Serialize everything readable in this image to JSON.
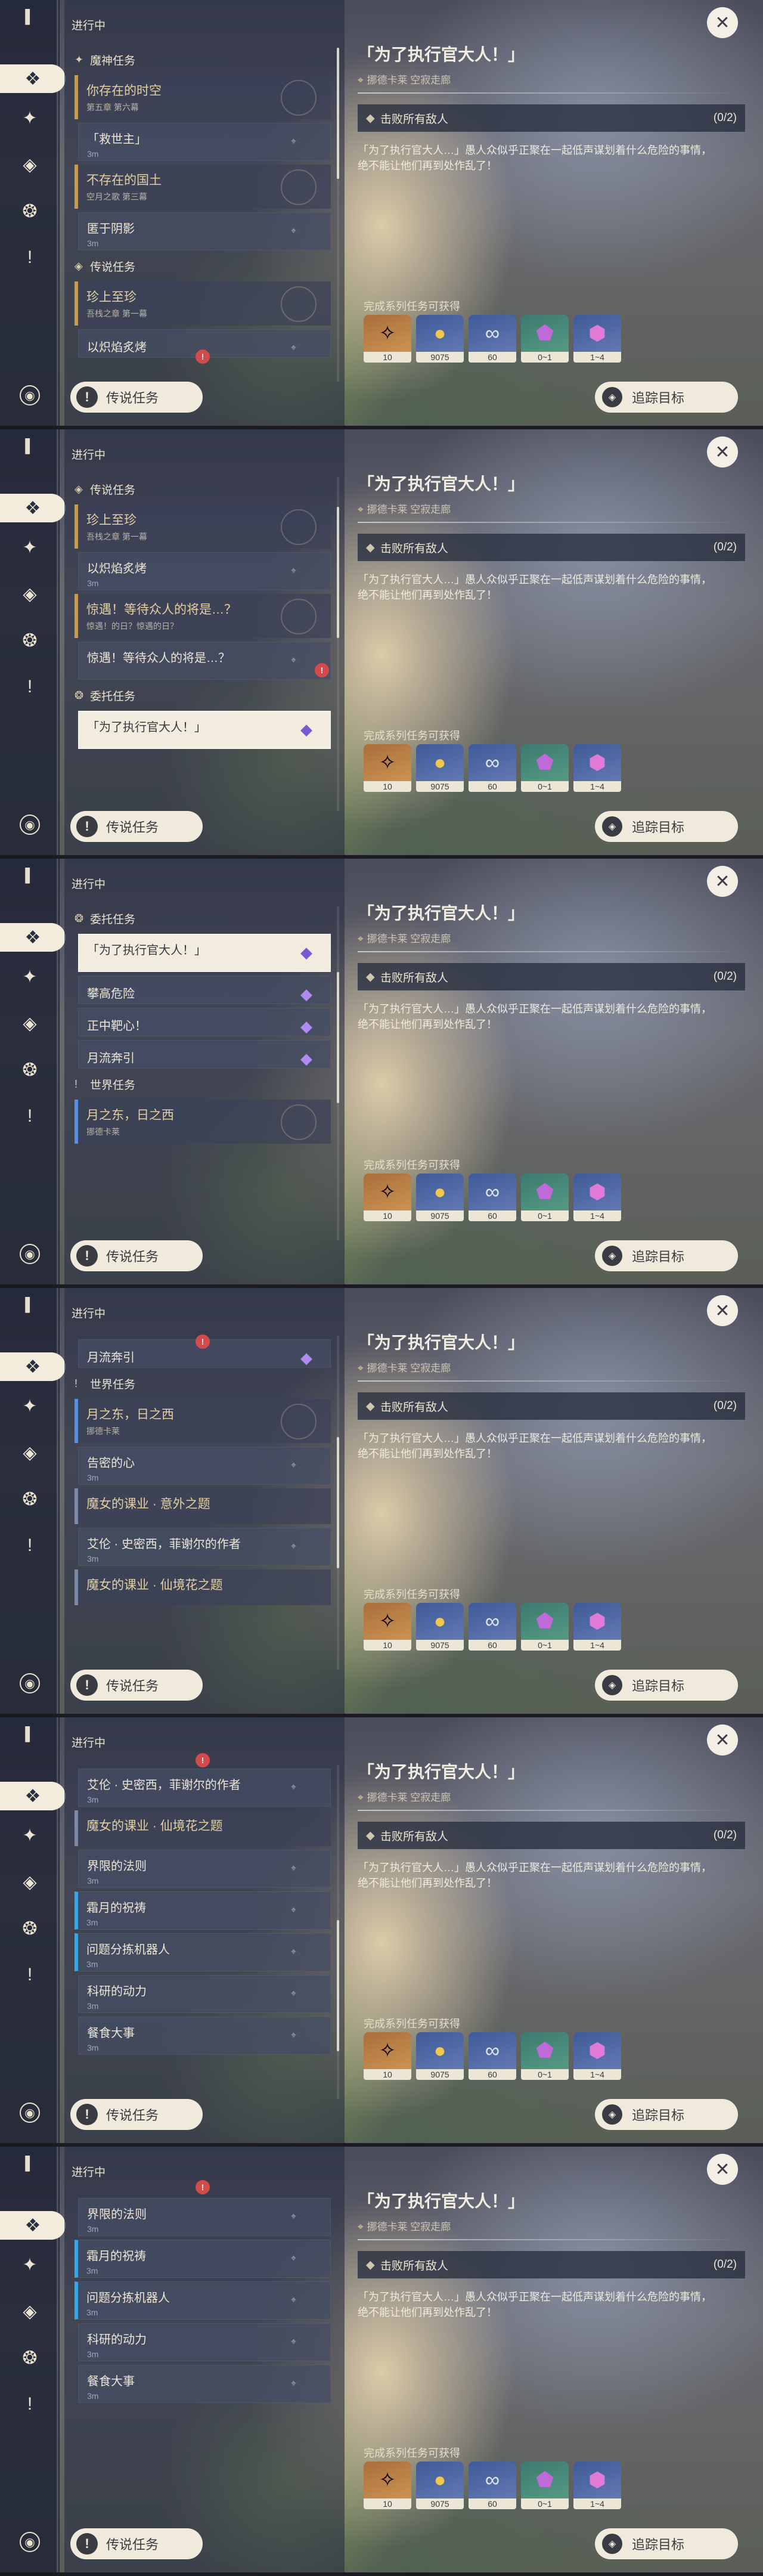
{
  "header": "进行中",
  "legend_button": "传说任务",
  "track_button": "追踪目标",
  "close_symbol": "✕",
  "detail": {
    "title": "「为了执行官大人！」",
    "location": "挪德卡莱 空寂走廊",
    "objective": "击败所有敌人",
    "objective_progress": "(0/2)",
    "description_line1": "「为了执行官大人…」愚人众似乎正聚在一起低声谋划着什么危险的事情，",
    "description_line2": "绝不能让他们再到处作乱了！",
    "rewards_title": "完成系列任务可获得",
    "rewards": [
      {
        "icon": "adventure-exp-icon",
        "qty": "10",
        "color": "orange"
      },
      {
        "icon": "mora-icon",
        "qty": "9075",
        "color": "blue"
      },
      {
        "icon": "companionship-exp-icon",
        "qty": "60",
        "color": "blue"
      },
      {
        "icon": "ore-icon",
        "qty": "0~1",
        "color": "green"
      },
      {
        "icon": "crystal-icon",
        "qty": "1~4",
        "color": "blue"
      }
    ]
  },
  "labels": {
    "archon": "魔神任务",
    "legend": "传说任务",
    "commission": "委托任务",
    "world": "世界任务",
    "witch1": "魔女的课业 · 意外之题",
    "witch2": "魔女的课业 · 仙境花之题",
    "t_timeshere": "你存在的时空",
    "t_timeshere_sub": "第五章 第六幕",
    "t_savior": "「救世主」",
    "t_3m": "3m",
    "t_nonexist": "不存在的国土",
    "t_nonexist_sub": "空月之歌 第三幕",
    "t_shadow": "匿于阴影",
    "t_treasure": "珍上至珍",
    "t_treasure_sub": "吾栈之章 第一幕",
    "t_flame": "以炽焰炙烤",
    "t_surprise": "惊遇！等待众人的将是…？",
    "t_surprise_sub": "惊遇！的日？惊遇的日？",
    "t_exec": "「为了执行官大人！」",
    "t_climb": "攀高危险",
    "t_target": "正中靶心！",
    "t_moon": "月流奔引",
    "t_east": "月之东，日之西",
    "t_east_sub": "挪德卡莱",
    "t_heart": "告密的心",
    "t_author": "艾伦 · 史密西，菲谢尔的作者",
    "t_bound": "界限的法则",
    "t_frost": "霜月的祝祷",
    "t_robot": "问题分拣机器人",
    "t_power": "科研的动力",
    "t_meal": "餐食大事"
  }
}
